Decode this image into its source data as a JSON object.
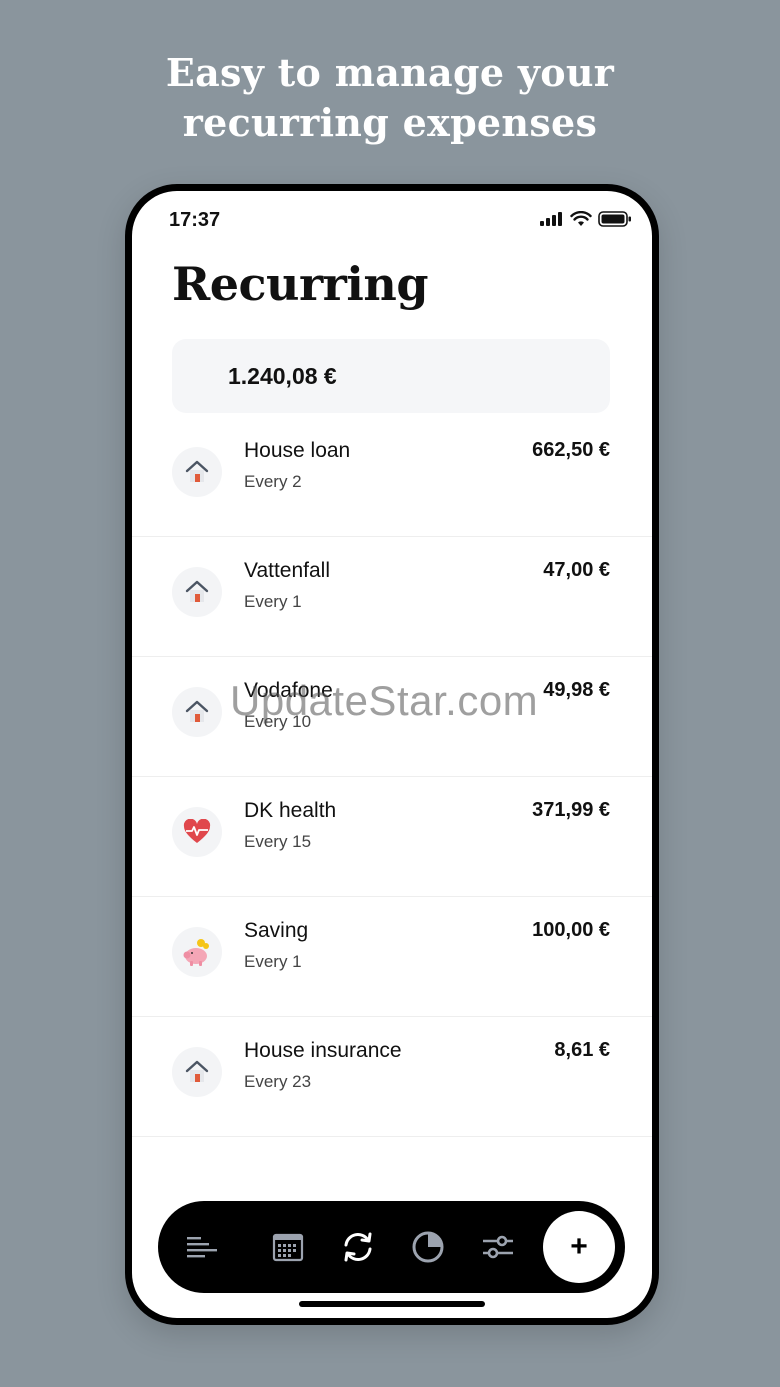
{
  "headline": {
    "line1": "Easy to manage your",
    "line2": "recurring expenses"
  },
  "status_bar": {
    "time": "17:37",
    "icons": [
      "signal-icon",
      "wifi-icon",
      "battery-icon"
    ]
  },
  "page": {
    "title": "Recurring",
    "total": "1.240,08 €"
  },
  "items": [
    {
      "name": "House loan",
      "frequency": "Every 2",
      "amount": "662,50 €",
      "icon": "house-icon"
    },
    {
      "name": "Vattenfall",
      "frequency": "Every 1",
      "amount": "47,00 €",
      "icon": "house-icon"
    },
    {
      "name": "Vodafone",
      "frequency": "Every 10",
      "amount": "49,98 €",
      "icon": "house-icon"
    },
    {
      "name": "DK health",
      "frequency": "Every 15",
      "amount": "371,99 €",
      "icon": "heart-icon"
    },
    {
      "name": "Saving",
      "frequency": "Every 1",
      "amount": "100,00 €",
      "icon": "piggy-bank-icon"
    },
    {
      "name": "House insurance",
      "frequency": "Every 23",
      "amount": "8,61 €",
      "icon": "house-icon"
    }
  ],
  "watermark": "UpdateStar.com",
  "tabbar": {
    "tabs": [
      "list-icon",
      "calendar-icon",
      "recurring-icon",
      "pie-chart-icon",
      "sliders-icon"
    ],
    "active": "recurring-icon",
    "add_label": "+"
  },
  "colors": {
    "background": "#8a959d",
    "accent_heart": "#e0474c",
    "house_door": "#e05a3a"
  }
}
